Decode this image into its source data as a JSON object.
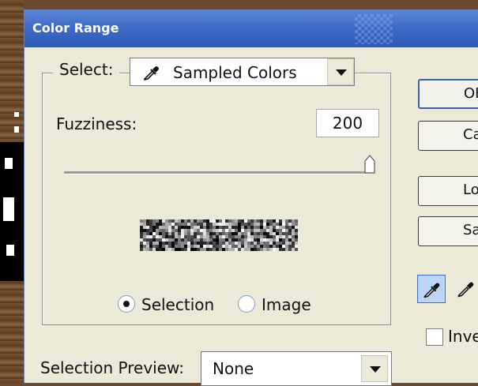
{
  "dialog": {
    "title": "Color Range"
  },
  "select": {
    "label": "Select:",
    "value": "Sampled Colors"
  },
  "fuzziness": {
    "label": "Fuzziness:",
    "value": "200",
    "level_fraction": 1.0
  },
  "view_mode": {
    "options": [
      {
        "label": "Selection",
        "selected": true
      },
      {
        "label": "Image",
        "selected": false
      }
    ]
  },
  "buttons": {
    "ok": "OK",
    "cancel": "Cancel",
    "load": "Load",
    "save": "Save"
  },
  "invert": {
    "label": "Invert",
    "checked": false
  },
  "selection_preview": {
    "label": "Selection Preview:",
    "value": "None"
  },
  "tools": [
    "eyedropper-icon",
    "eyedropper-plus-icon"
  ],
  "colors": {
    "title_bar": "#3f6cc9",
    "dialog_bg": "#ece9d8",
    "default_button_border": "#3b5fb0"
  }
}
